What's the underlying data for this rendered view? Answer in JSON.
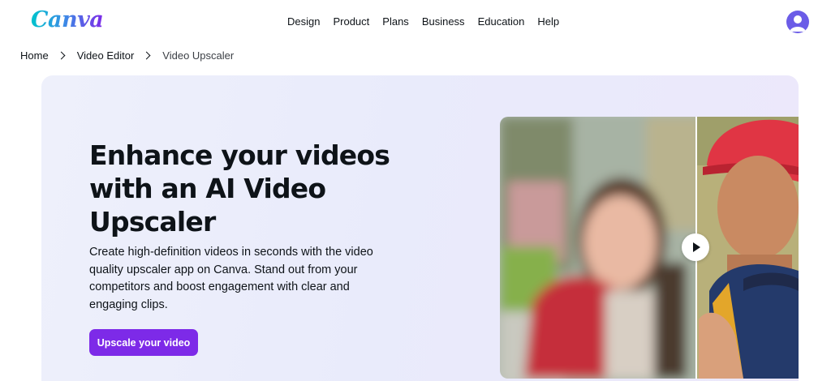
{
  "header": {
    "logo": "Canva",
    "nav": [
      "Design",
      "Product",
      "Plans",
      "Business",
      "Education",
      "Help"
    ]
  },
  "breadcrumb": {
    "items": [
      "Home",
      "Video Editor",
      "Video Upscaler"
    ]
  },
  "hero": {
    "headline": "Enhance your videos with an AI Video Upscaler",
    "description": "Create high-definition videos in seconds with the video quality upscaler app on Canva. Stand out from your competitors and boost engagement with clear and engaging clips.",
    "cta_label": "Upscale your video"
  },
  "colors": {
    "brand_purple": "#7d2ae8",
    "hero_bg": "#eceefb",
    "avatar": "#6b5ce7"
  }
}
